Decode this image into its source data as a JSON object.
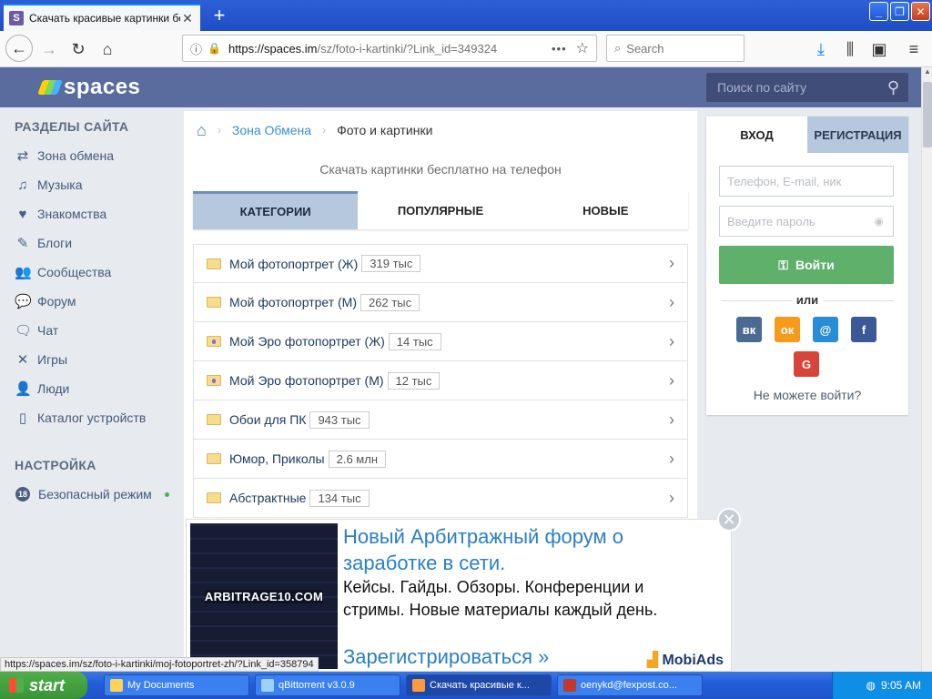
{
  "browser": {
    "tab_title": "Скачать красивые картинки бе",
    "tab_favicon": "S",
    "url_host": "https://spaces.im",
    "url_path": "/sz/foto-i-kartinki/?Link_id=349324",
    "search_placeholder": "Search",
    "status_url": "https://spaces.im/sz/foto-i-kartinki/moj-fotoportret-zh/?Link_id=358794"
  },
  "site": {
    "logo": "spaces",
    "search_placeholder": "Поиск по сайту"
  },
  "sidebar": {
    "heading_sections": "РАЗДЕЛЫ САЙТА",
    "items": [
      {
        "label": "Зона обмена",
        "icon": "exchange-icon"
      },
      {
        "label": "Музыка",
        "icon": "music-icon"
      },
      {
        "label": "Знакомства",
        "icon": "heart-icon"
      },
      {
        "label": "Блоги",
        "icon": "pen-icon"
      },
      {
        "label": "Сообщества",
        "icon": "people-icon"
      },
      {
        "label": "Форум",
        "icon": "forum-icon"
      },
      {
        "label": "Чат",
        "icon": "chat-icon"
      },
      {
        "label": "Игры",
        "icon": "games-icon"
      },
      {
        "label": "Люди",
        "icon": "person-icon"
      },
      {
        "label": "Каталог устройств",
        "icon": "phone-icon"
      }
    ],
    "heading_settings": "НАСТРОЙКА",
    "safe_mode_badge": "18",
    "safe_mode_label": "Безопасный режим"
  },
  "breadcrumb": {
    "link": "Зона Обмена",
    "current": "Фото и картинки"
  },
  "main": {
    "subtitle": "Скачать картинки бесплатно на телефон",
    "tabs": [
      "КАТЕГОРИИ",
      "ПОПУЛЯРНЫЕ",
      "НОВЫЕ"
    ],
    "categories": [
      {
        "name": "Мой фотопортрет (Ж)",
        "count": "319 тыс",
        "icon": "folder-icon"
      },
      {
        "name": "Мой фотопортрет (М)",
        "count": "262 тыс",
        "icon": "folder-icon"
      },
      {
        "name": "Мой Эро фотопортрет (Ж)",
        "count": "14 тыс",
        "icon": "folder-person-icon"
      },
      {
        "name": "Мой Эро фотопортрет (М)",
        "count": "12 тыс",
        "icon": "folder-person-icon"
      },
      {
        "name": "Обои для ПК",
        "count": "943 тыс",
        "icon": "folder-icon"
      },
      {
        "name": "Юмор, Приколы",
        "count": "2.6 млн",
        "icon": "folder-icon"
      },
      {
        "name": "Абстрактные",
        "count": "134 тыс",
        "icon": "folder-icon"
      }
    ]
  },
  "auth": {
    "tab_login": "ВХОД",
    "tab_register": "РЕГИСТРАЦИЯ",
    "login_placeholder": "Телефон, E-mail, ник",
    "password_placeholder": "Введите пароль",
    "login_button": "Войти",
    "or": "или",
    "social": [
      {
        "name": "vk",
        "label": "вк",
        "color": "#4a6b91"
      },
      {
        "name": "ok",
        "label": "ок",
        "color": "#f59a1a"
      },
      {
        "name": "mail",
        "label": "@",
        "color": "#2a8bd6"
      },
      {
        "name": "facebook",
        "label": "f",
        "color": "#3b5998"
      },
      {
        "name": "google",
        "label": "G",
        "color": "#d9443a"
      }
    ],
    "cant_login": "Не можете войти?"
  },
  "ad": {
    "image_text": "ARBITRAGE10.COM",
    "title": "Новый Арбитражный форум о заработке в сети.",
    "text": "Кейсы. Гайды. Обзоры. Конференции и стримы. Новые материалы каждый день.",
    "cta": "Зарегистрироваться »",
    "logo": "MobiAds"
  },
  "taskbar": {
    "start": "start",
    "tasks": [
      "My Documents",
      "qBittorrent v3.0.9",
      "Скачать красивые к...",
      "oenykd@fexpost.co..."
    ],
    "time": "9:05 AM"
  },
  "colors": {
    "header": "#5a6b9d",
    "accent_link": "#3a8ed4",
    "login_green": "#5eb06a",
    "tab_active": "#b6c8dd"
  }
}
